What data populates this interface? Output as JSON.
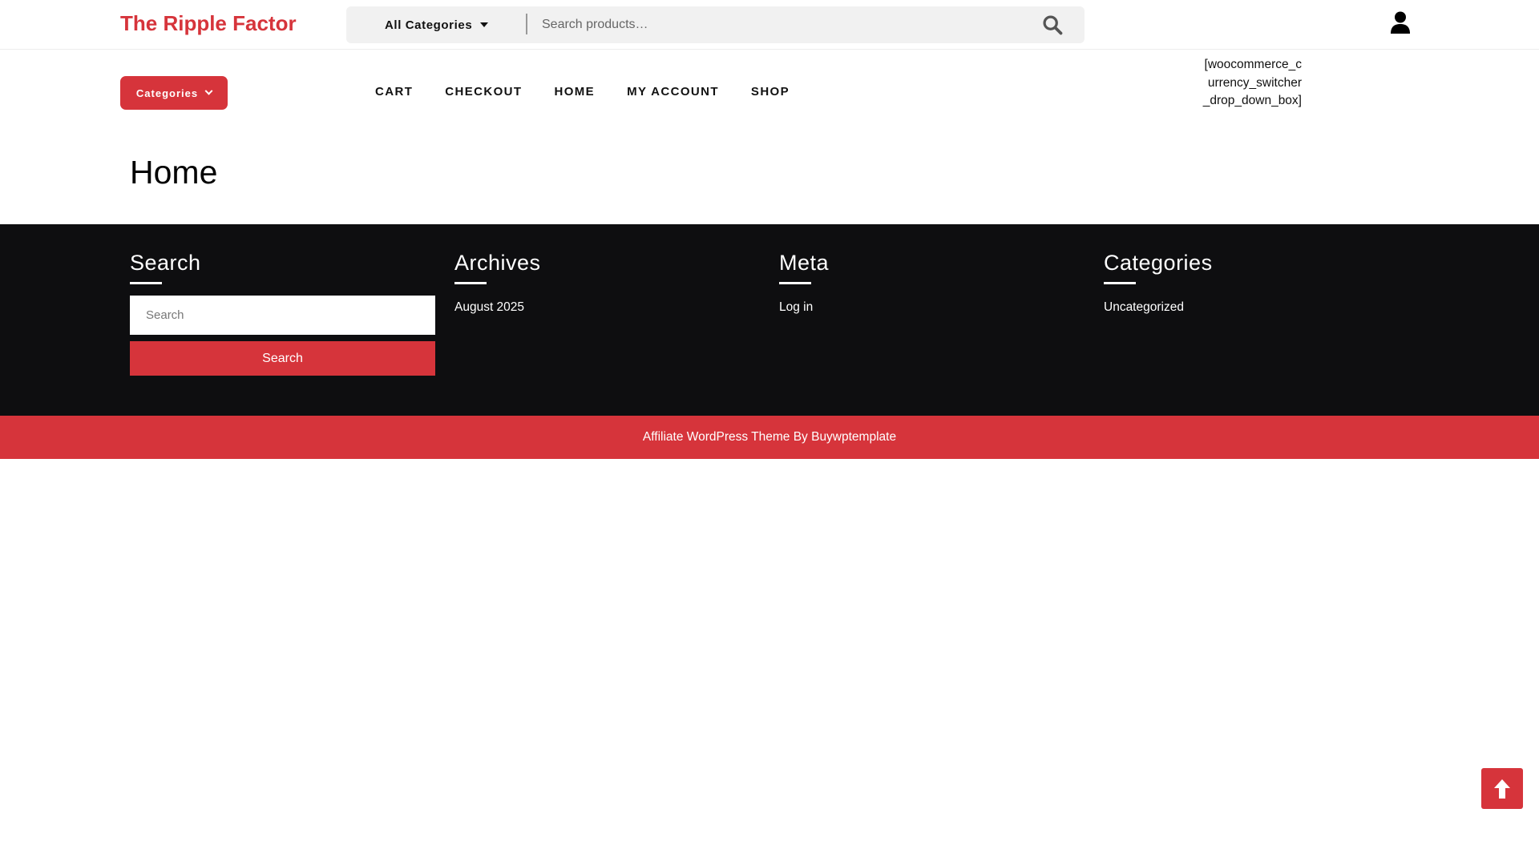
{
  "header": {
    "site_title": "The Ripple Factor",
    "category_select": "All Categories",
    "search_placeholder": "Search products…",
    "search_icon": "search-icon",
    "user_icon": "user-icon"
  },
  "nav": {
    "categories_button": "Categories",
    "items": [
      "CART",
      "CHECKOUT",
      "HOME",
      "MY ACCOUNT",
      "SHOP"
    ],
    "shortcode_text": "[woocommerce_currency_switcher_drop_down_box]"
  },
  "page": {
    "title": "Home"
  },
  "footer": {
    "search": {
      "title": "Search",
      "placeholder": "Search",
      "button": "Search"
    },
    "archives": {
      "title": "Archives",
      "items": [
        "August 2025"
      ]
    },
    "meta": {
      "title": "Meta",
      "items": [
        "Log in"
      ]
    },
    "categories": {
      "title": "Categories",
      "items": [
        "Uncategorized"
      ]
    },
    "copyright": "Affiliate WordPress Theme By Buywptemplate"
  },
  "back_to_top_icon": "arrow-up-icon",
  "colors": {
    "accent": "#d6343b",
    "footer_bg": "#0e0e10",
    "search_bg": "#f1f1f1"
  }
}
